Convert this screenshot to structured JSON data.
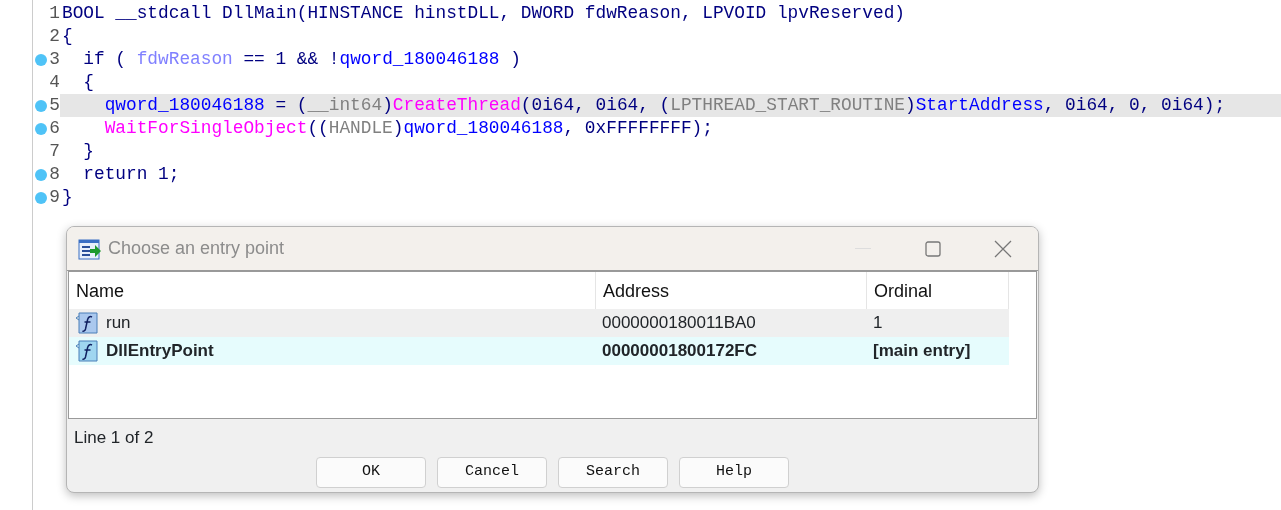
{
  "editor": {
    "lines": [
      {
        "number": "1",
        "breakpoint": false,
        "highlighted": false,
        "tokens": [
          {
            "kind": "plain",
            "text": "BOOL __stdcall DllMain(HINSTANCE hinstDLL, DWORD fdwReason, LPVOID lpvReserved)"
          }
        ]
      },
      {
        "number": "2",
        "breakpoint": false,
        "highlighted": false,
        "tokens": [
          {
            "kind": "plain",
            "text": "{"
          }
        ]
      },
      {
        "number": "3",
        "breakpoint": true,
        "highlighted": false,
        "tokens": [
          {
            "kind": "plain",
            "text": "  if ( "
          },
          {
            "kind": "arg",
            "text": "fdwReason"
          },
          {
            "kind": "plain",
            "text": " == 1 && !"
          },
          {
            "kind": "var",
            "text": "qword_180046188"
          },
          {
            "kind": "plain",
            "text": " )"
          }
        ]
      },
      {
        "number": "4",
        "breakpoint": false,
        "highlighted": false,
        "tokens": [
          {
            "kind": "plain",
            "text": "  {"
          }
        ]
      },
      {
        "number": "5",
        "breakpoint": true,
        "highlighted": true,
        "tokens": [
          {
            "kind": "var",
            "text": "    qword_180046188"
          },
          {
            "kind": "plain",
            "text": " = ("
          },
          {
            "kind": "type",
            "text": "__int64"
          },
          {
            "kind": "plain",
            "text": ")"
          },
          {
            "kind": "func",
            "text": "CreateThread"
          },
          {
            "kind": "plain",
            "text": "(0i64, 0i64, ("
          },
          {
            "kind": "type",
            "text": "LPTHREAD_START_ROUTINE"
          },
          {
            "kind": "plain",
            "text": ")"
          },
          {
            "kind": "var",
            "text": "StartAddress"
          },
          {
            "kind": "plain",
            "text": ", 0i64, 0, 0i64);"
          }
        ]
      },
      {
        "number": "6",
        "breakpoint": true,
        "highlighted": false,
        "tokens": [
          {
            "kind": "func",
            "text": "    WaitForSingleObject"
          },
          {
            "kind": "plain",
            "text": "(("
          },
          {
            "kind": "type",
            "text": "HANDLE"
          },
          {
            "kind": "plain",
            "text": ")"
          },
          {
            "kind": "var",
            "text": "qword_180046188"
          },
          {
            "kind": "plain",
            "text": ", 0xFFFFFFFF);"
          }
        ]
      },
      {
        "number": "7",
        "breakpoint": false,
        "highlighted": false,
        "tokens": [
          {
            "kind": "plain",
            "text": "  }"
          }
        ]
      },
      {
        "number": "8",
        "breakpoint": true,
        "highlighted": false,
        "tokens": [
          {
            "kind": "plain",
            "text": "  return 1;"
          }
        ]
      },
      {
        "number": "9",
        "breakpoint": true,
        "highlighted": false,
        "tokens": [
          {
            "kind": "plain",
            "text": "}"
          }
        ]
      }
    ]
  },
  "dialog": {
    "title": "Choose an entry point",
    "columns": [
      "Name",
      "Address",
      "Ordinal"
    ],
    "rows": [
      {
        "name": "run",
        "address": "0000000180011BA0",
        "ordinal": "1",
        "selected": true,
        "main": false
      },
      {
        "name": "DllEntryPoint",
        "address": "00000001800172FC",
        "ordinal": "[main entry]",
        "selected": false,
        "main": true
      }
    ],
    "status": "Line 1 of 2",
    "buttons": [
      "OK",
      "Cancel",
      "Search",
      "Help"
    ]
  }
}
